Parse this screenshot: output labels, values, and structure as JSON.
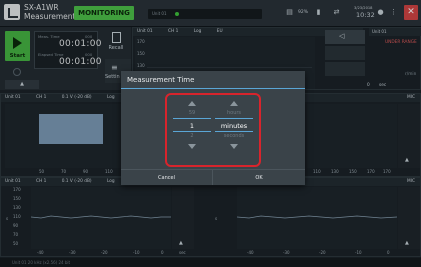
{
  "app": {
    "name_line1": "SX-A1WR",
    "name_line2": "Measurement"
  },
  "header": {
    "monitoring_label": "MONITORING",
    "unit_label": "Unit 01",
    "battery": "92%",
    "date": "3/23/2018",
    "time": "10:32"
  },
  "controls": {
    "start_label": "Start",
    "meas_time_label": "Meas. Time",
    "meas_time_aux": "000",
    "meas_time_value": "00:01:00",
    "elapsed_time_label": "Elapsed Time",
    "elapsed_time_aux": "000",
    "elapsed_time_value": "00:01:00",
    "recall_label": "Recall",
    "setting_label": "Settin",
    "up_label": "▲"
  },
  "top_panel": {
    "unit": "Unit 01",
    "ch": "CH 1",
    "scale": "Log",
    "unit_sel": "EU",
    "yticks": [
      "170",
      "150",
      "130"
    ],
    "right_label": "UNDER RANGE",
    "right_unit": "r/min",
    "sec_label": "sec",
    "sec_value": "0"
  },
  "mid_panel": {
    "unit": "Unit 01",
    "ch": "CH 1",
    "range": "0.1 V (-20 dB)",
    "scale": "Log",
    "xticks": [
      "50",
      "70",
      "90",
      "110"
    ],
    "right_ticks": [
      "110",
      "130",
      "150",
      "170"
    ],
    "right_last": "170",
    "unit_sel": "EU",
    "mic": "MIC"
  },
  "bottom_panel": {
    "unit": "Unit 01",
    "ch": "CH 1",
    "range": "0.1 V (-20 dB)",
    "scale": "Log",
    "yticks": [
      "170",
      "150",
      "130",
      "110",
      "90",
      "70",
      "50"
    ],
    "xticks": [
      "-40",
      "-30",
      "-20",
      "-10",
      "0"
    ],
    "xticks_right": [
      "-40",
      "-30",
      "-20",
      "-10",
      "0"
    ],
    "sec_label": "sec",
    "mic": "MIC",
    "ylabel_left": "s",
    "ylabel_right": "s"
  },
  "dialog": {
    "title": "Measurement Time",
    "value_col": {
      "above": "59",
      "selected": "1",
      "below": "2"
    },
    "unit_col": {
      "above": "hours",
      "selected": "minutes",
      "below": "seconds"
    },
    "cancel_label": "Cancel",
    "ok_label": "OK"
  },
  "statusbar": {
    "text": "Unit 01   20 kHz (x2.56)   24 bit"
  }
}
